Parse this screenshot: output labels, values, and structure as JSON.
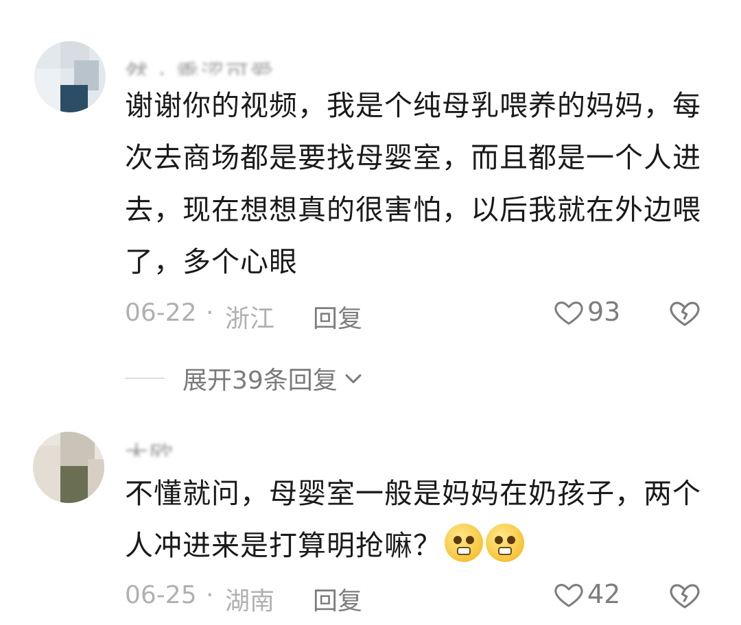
{
  "comments": [
    {
      "username": "然 · 乘涩可爱",
      "text": "谢谢你的视频，我是个纯母乳喂养的妈妈，每次去商场都是要找母婴室，而且都是一个人进去，现在想想真的很害怕，以后我就在外边喂了，多个心眼",
      "date": "06-22",
      "separator": "·",
      "location": "浙江",
      "reply_label": "回复",
      "likes": "93",
      "avatar_colors": [
        "#c9d6de",
        "#8a9aa8",
        "#2c4d66",
        "#e3e8ec"
      ]
    },
    {
      "username": "大欧",
      "text": "不懂就问，母婴室一般是妈妈在奶孩子，两个人冲进来是打算明抢嘛？",
      "date": "06-25",
      "separator": "·",
      "location": "湖南",
      "reply_label": "回复",
      "likes": "42",
      "emoji_icons": [
        "pleading-face-icon",
        "pleading-face-icon"
      ],
      "avatar_colors": [
        "#b8b8a8",
        "#6a6e52",
        "#d8cfc4",
        "#eae6df"
      ]
    }
  ],
  "expand_replies": {
    "label": "展开39条回复"
  },
  "colors": {
    "text": "#1a1a1a",
    "meta": "#b0b0b0",
    "action": "#7d7d7d"
  }
}
